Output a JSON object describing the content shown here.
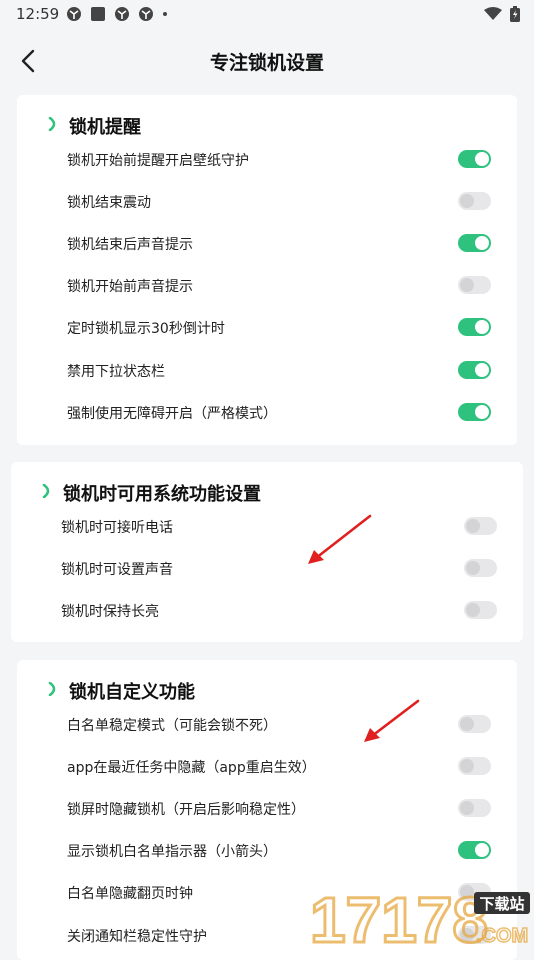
{
  "status_bar": {
    "time": "12:59",
    "left_icons": [
      "app-icon",
      "square-app-icon",
      "app-icon",
      "app-icon",
      "dot-icon"
    ],
    "right_icons": [
      "wifi-icon",
      "battery-charging-icon"
    ]
  },
  "header": {
    "title": "专注锁机设置",
    "back_icon": "chevron-left-icon"
  },
  "colors": {
    "accent": "#2fc27f",
    "toggle_off": "#e7e7e9",
    "arrow": "#e02020"
  },
  "sections": [
    {
      "title": "锁机提醒",
      "items": [
        {
          "label": "锁机开始前提醒开启壁纸守护",
          "on": true
        },
        {
          "label": "锁机结束震动",
          "on": false
        },
        {
          "label": "锁机结束后声音提示",
          "on": true
        },
        {
          "label": "锁机开始前声音提示",
          "on": false
        },
        {
          "label": "定时锁机显示30秒倒计时",
          "on": true
        },
        {
          "label": "禁用下拉状态栏",
          "on": true
        },
        {
          "label": "强制使用无障碍开启（严格模式）",
          "on": true
        }
      ]
    },
    {
      "title": "锁机时可用系统功能设置",
      "items": [
        {
          "label": "锁机时可接听电话",
          "on": false
        },
        {
          "label": "锁机时可设置声音",
          "on": false
        },
        {
          "label": "锁机时保持长亮",
          "on": false
        }
      ]
    },
    {
      "title": "锁机自定义功能",
      "items": [
        {
          "label": "白名单稳定模式（可能会锁不死）",
          "on": false
        },
        {
          "label": "app在最近任务中隐藏（app重启生效）",
          "on": false
        },
        {
          "label": "锁屏时隐藏锁机（开启后影响稳定性）",
          "on": false
        },
        {
          "label": "显示锁机白名单指示器（小箭头）",
          "on": true
        },
        {
          "label": "白名单隐藏翻页时钟",
          "on": false
        },
        {
          "label": "关闭通知栏稳定性守护",
          "on": false
        }
      ]
    }
  ],
  "watermark": {
    "digits": "17178",
    "badge": "下载站",
    "domain": ".COM"
  }
}
